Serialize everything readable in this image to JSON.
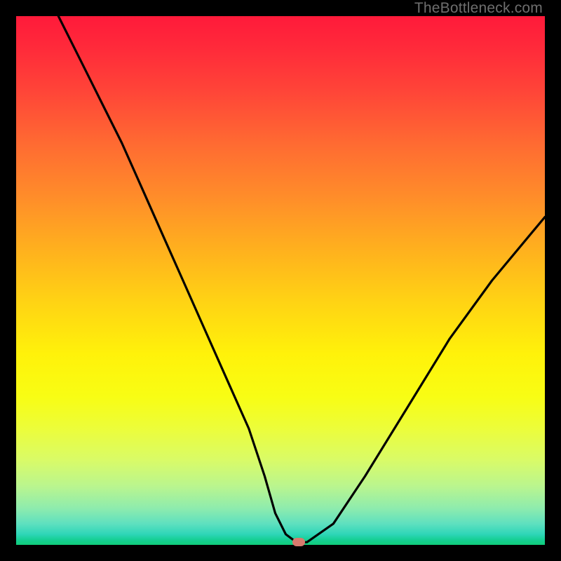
{
  "watermark": "TheBottleneck.com",
  "chart_data": {
    "type": "line",
    "title": "",
    "xlabel": "",
    "ylabel": "",
    "xlim": [
      0,
      100
    ],
    "ylim": [
      0,
      100
    ],
    "series": [
      {
        "name": "bottleneck-curve",
        "x": [
          8,
          12,
          16,
          20,
          24,
          28,
          32,
          36,
          40,
          44,
          47,
          49,
          51,
          53,
          55,
          60,
          66,
          74,
          82,
          90,
          100
        ],
        "values": [
          100,
          92,
          84,
          76,
          67,
          58,
          49,
          40,
          31,
          22,
          13,
          6,
          2,
          0.5,
          0.5,
          4,
          13,
          26,
          39,
          50,
          62
        ]
      }
    ],
    "marker": {
      "x": 53.5,
      "y": 0.5,
      "color": "#d87a6e"
    },
    "background_gradient": {
      "direction": "vertical",
      "stops": [
        {
          "pos": 0,
          "color": "#ff1a3a"
        },
        {
          "pos": 34,
          "color": "#ff8c2a"
        },
        {
          "pos": 64,
          "color": "#fff20a"
        },
        {
          "pos": 93,
          "color": "#8fecad"
        },
        {
          "pos": 100,
          "color": "#10cd7a"
        }
      ]
    }
  }
}
